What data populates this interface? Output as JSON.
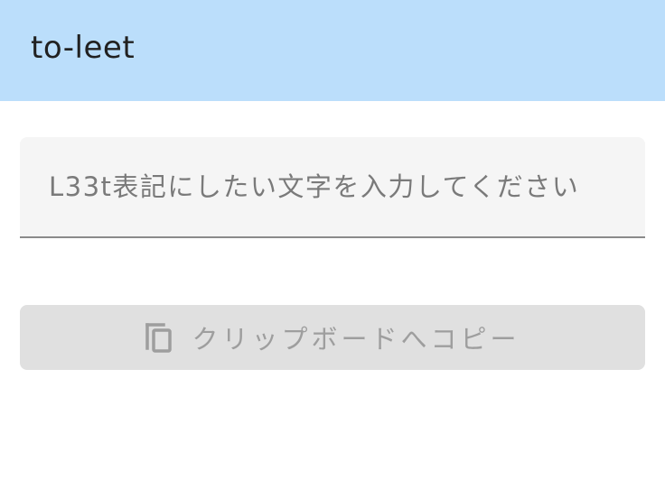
{
  "app_bar": {
    "title": "to-leet",
    "background": "#bbdefb"
  },
  "input": {
    "placeholder": "L33t表記にしたい文字を入力してください",
    "value": ""
  },
  "copy_button": {
    "label": "クリップボードへコピー",
    "icon": "content-copy-icon",
    "state": "disabled"
  }
}
